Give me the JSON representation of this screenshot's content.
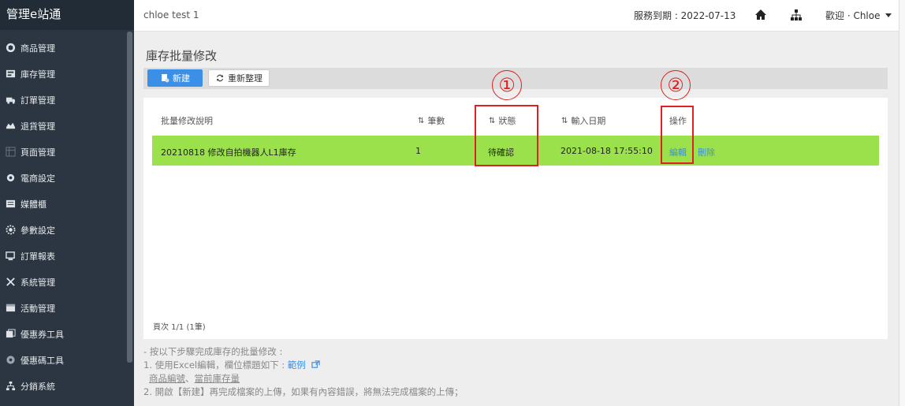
{
  "sidebar": {
    "brand": "管理e站通",
    "items": [
      {
        "label": "商品管理",
        "icon": "box-icon"
      },
      {
        "label": "庫存管理",
        "icon": "inventory-icon"
      },
      {
        "label": "訂單管理",
        "icon": "truck-icon"
      },
      {
        "label": "退貨管理",
        "icon": "return-icon"
      },
      {
        "label": "頁面管理",
        "icon": "page-icon"
      },
      {
        "label": "電商設定",
        "icon": "gear-icon"
      },
      {
        "label": "媒體櫃",
        "icon": "media-icon"
      },
      {
        "label": "參數設定",
        "icon": "cog-icon"
      },
      {
        "label": "訂單報表",
        "icon": "report-icon"
      },
      {
        "label": "系統管理",
        "icon": "tools-icon"
      },
      {
        "label": "活動管理",
        "icon": "calendar-icon"
      },
      {
        "label": "優惠券工具",
        "icon": "coupon-icon"
      },
      {
        "label": "優惠碼工具",
        "icon": "code-icon"
      },
      {
        "label": "分銷系統",
        "icon": "network-icon"
      }
    ]
  },
  "topbar": {
    "store_name": "chloe test 1",
    "service_expiry": "服務到期 : 2022-07-13",
    "welcome": "歡迎 · Chloe"
  },
  "main": {
    "title": "庫存批量修改",
    "new_button": "新建",
    "refresh_button": "重新整理",
    "table": {
      "headers": {
        "description": "批量修改說明",
        "count": "筆數",
        "status": "狀態",
        "date": "輸入日期",
        "actions": "操作"
      },
      "rows": [
        {
          "description": "20210818 修改自拍機器人L1庫存",
          "count": "1",
          "status": "待確認",
          "date": "2021-08-18 17:55:10",
          "edit": "編輯",
          "delete": "刪除"
        }
      ],
      "pager": "頁次 1/1 (1筆)"
    },
    "notes": {
      "line1": "- 按以下步驟完成庫存的批量修改 :",
      "line2_prefix": "1. 使用Excel編輯，欄位標題如下 : ",
      "line2_link": "範例",
      "line3_a": "商品編號",
      "line3_sep": "、",
      "line3_b": "當前庫存量",
      "line4": "2. 開啟【新建】再完成檔案的上傳，如果有內容錯誤，將無法完成檔案的上傳；"
    }
  },
  "annotations": {
    "marker1": "①",
    "marker2": "②",
    "color": "#e02020"
  },
  "colors": {
    "sidebar_bg": "#2b3642",
    "row_highlight": "#9be14b",
    "primary": "#3c8fe6"
  }
}
